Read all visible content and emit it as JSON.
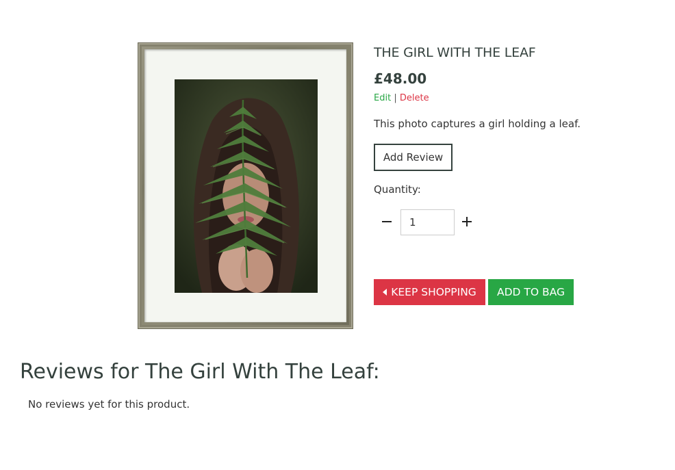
{
  "product": {
    "title": "THE GIRL WITH THE LEAF",
    "price": "£48.00",
    "edit_label": "Edit",
    "separator": "|",
    "delete_label": "Delete",
    "description": "This photo captures a girl holding a leaf.",
    "add_review_label": "Add Review",
    "quantity_label": "Quantity:",
    "quantity_value": "1",
    "keep_shopping_label": "KEEP SHOPPING",
    "add_to_bag_label": "ADD TO BAG"
  },
  "reviews": {
    "heading": "Reviews for The Girl With The Leaf:",
    "empty_text": "No reviews yet for this product."
  },
  "icons": {
    "minus": "minus-icon",
    "plus": "plus-icon",
    "keep_shopping": "caret-left-icon"
  },
  "colors": {
    "heading": "#34413d",
    "danger": "#dc3545",
    "success": "#28a745"
  }
}
